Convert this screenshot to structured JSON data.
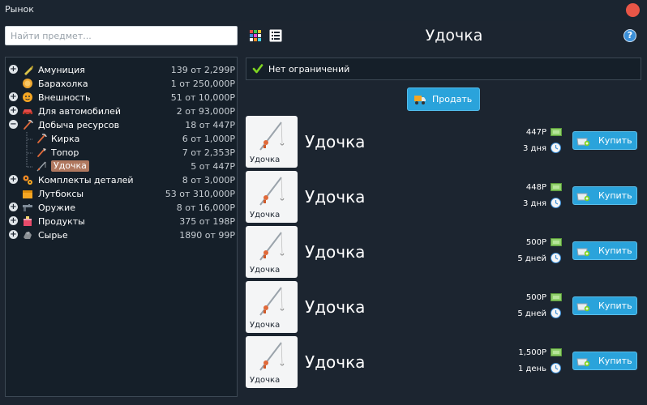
{
  "window": {
    "title": "Рынок"
  },
  "search": {
    "placeholder": "Найти предмет..."
  },
  "page_title": "Удочка",
  "help_label": "?",
  "filter": {
    "label": "Нет ограничений"
  },
  "sell_button": {
    "label": "Продать"
  },
  "colors": {
    "accent": "#2aa3db",
    "selected": "#b0785f",
    "close": "#e85647",
    "panel": "#151f29",
    "background": "#1c2530"
  },
  "categories": [
    {
      "label": "Амуниция",
      "count": "139 от 2,299Р",
      "icon": "ammo-icon",
      "expander": "+"
    },
    {
      "label": "Барахолка",
      "count": "1 от 250,000Р",
      "icon": "coin-icon",
      "expander": ""
    },
    {
      "label": "Внешность",
      "count": "51 от 10,000Р",
      "icon": "face-icon",
      "expander": "+"
    },
    {
      "label": "Для автомобилей",
      "count": "2 от 93,000Р",
      "icon": "car-icon",
      "expander": "+"
    },
    {
      "label": "Добыча ресурсов",
      "count": "18 от 447Р",
      "icon": "pickaxe-icon",
      "expander": "−"
    },
    {
      "label": "Кирка",
      "count": "6 от 1,000Р",
      "icon": "pickaxe-icon",
      "expander": ""
    },
    {
      "label": "Топор",
      "count": "7 от 2,353Р",
      "icon": "axe-icon",
      "expander": ""
    },
    {
      "label": "Удочка",
      "count": "5 от 447Р",
      "icon": "fishing-rod-icon",
      "expander": ""
    },
    {
      "label": "Комплекты деталей",
      "count": "8 от 3,000Р",
      "icon": "gears-icon",
      "expander": "+"
    },
    {
      "label": "Лутбоксы",
      "count": "53 от 310,000Р",
      "icon": "lootbox-icon",
      "expander": ""
    },
    {
      "label": "Оружие",
      "count": "8 от 16,000Р",
      "icon": "gun-icon",
      "expander": "+"
    },
    {
      "label": "Продукты",
      "count": "375 от 198Р",
      "icon": "food-icon",
      "expander": "+"
    },
    {
      "label": "Сырье",
      "count": "1890 от 99Р",
      "icon": "ore-icon",
      "expander": "+"
    }
  ],
  "listings": [
    {
      "thumb_label": "Удочка",
      "name": "Удочка",
      "price": "447Р",
      "duration": "3 дня",
      "buy_label": "Купить"
    },
    {
      "thumb_label": "Удочка",
      "name": "Удочка",
      "price": "448Р",
      "duration": "3 дня",
      "buy_label": "Купить"
    },
    {
      "thumb_label": "Удочка",
      "name": "Удочка",
      "price": "500Р",
      "duration": "5 дней",
      "buy_label": "Купить"
    },
    {
      "thumb_label": "Удочка",
      "name": "Удочка",
      "price": "500Р",
      "duration": "5 дней",
      "buy_label": "Купить"
    },
    {
      "thumb_label": "Удочка",
      "name": "Удочка",
      "price": "1,500Р",
      "duration": "1 день",
      "buy_label": "Купить"
    }
  ]
}
